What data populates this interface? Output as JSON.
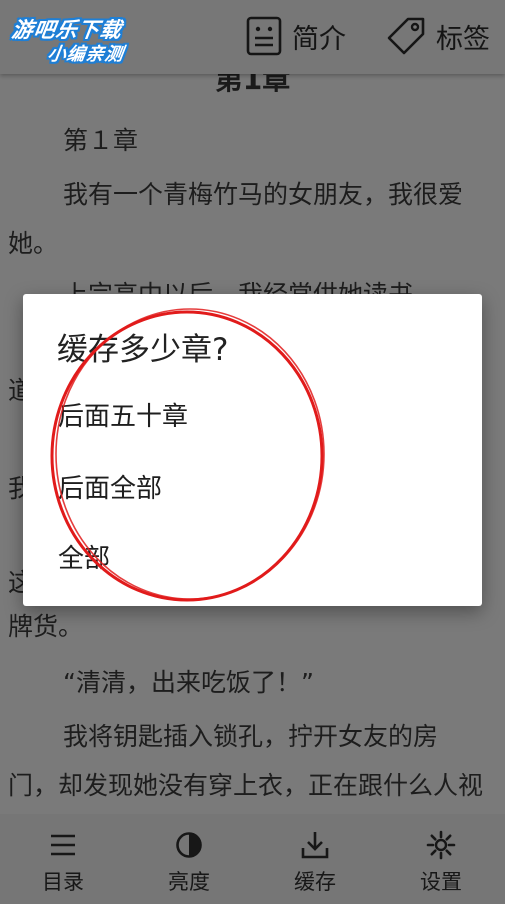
{
  "watermark": {
    "line1": "游吧乐下载",
    "line2": "小编亲测"
  },
  "header": {
    "actions": [
      {
        "label": "简介",
        "icon": "intro-icon"
      },
      {
        "label": "标签",
        "icon": "tag-icon"
      }
    ]
  },
  "reader": {
    "chapter_heading": "第1章",
    "paragraphs": [
      "第１章",
      "我有一个青梅竹马的女朋友，我很爱她。",
      "上完高中以后，我经常供她读书，",
      "道",
      "我",
      "这",
      "牌货。",
      "“清清，出来吃饭了！”",
      "我将钥匙插入锁孔，拧开女友的房门，却发现她没有穿上衣，正在跟什么人视频"
    ]
  },
  "dialog": {
    "title": "缓存多少章?",
    "options": [
      "后面五十章",
      "后面全部",
      "全部"
    ]
  },
  "bottom_nav": [
    {
      "label": "目录",
      "icon": "menu-list-icon"
    },
    {
      "label": "亮度",
      "icon": "brightness-icon"
    },
    {
      "label": "缓存",
      "icon": "download-icon"
    },
    {
      "label": "设置",
      "icon": "settings-gear-icon"
    }
  ],
  "colors": {
    "annotation_circle": "#e11b1b",
    "dialog_background": "#ffffff",
    "dim_overlay": "#7a7a7a",
    "watermark_outline": "#1e7fd6"
  }
}
